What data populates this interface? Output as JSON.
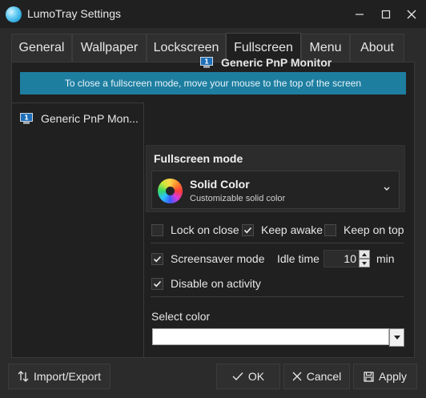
{
  "window": {
    "title": "LumoTray Settings"
  },
  "tabs": [
    {
      "label": "General",
      "active": false
    },
    {
      "label": "Wallpaper",
      "active": false
    },
    {
      "label": "Lockscreen",
      "active": false
    },
    {
      "label": "Fullscreen",
      "active": true
    },
    {
      "label": "Menu",
      "active": false
    },
    {
      "label": "About",
      "active": false
    }
  ],
  "banner": {
    "text": "To close a fullscreen mode, move your mouse to the top of the screen"
  },
  "monitors": [
    {
      "label": "Generic PnP Mon...",
      "selected": true
    }
  ],
  "monitor_heading": "Generic PnP Monitor",
  "fullscreen_mode": {
    "title": "Fullscreen mode",
    "selected_name": "Solid Color",
    "selected_desc": "Customizable solid color"
  },
  "options": {
    "lock_on_close": {
      "label": "Lock on close",
      "checked": false
    },
    "keep_awake": {
      "label": "Keep awake",
      "checked": true
    },
    "keep_on_top": {
      "label": "Keep on top",
      "checked": false
    },
    "screensaver_mode": {
      "label": "Screensaver mode",
      "checked": true
    },
    "idle_time_label": "Idle time",
    "idle_time_value": "10",
    "idle_time_unit": "min",
    "disable_on_activity": {
      "label": "Disable on activity",
      "checked": true
    }
  },
  "color": {
    "label": "Select color",
    "value": "#ffffff"
  },
  "buttons": {
    "import_export": "Import/Export",
    "ok": "OK",
    "cancel": "Cancel",
    "apply": "Apply"
  },
  "colors": {
    "accent_banner": "#1e7ea0",
    "background": "#2b2b2b",
    "panel": "#202020"
  }
}
